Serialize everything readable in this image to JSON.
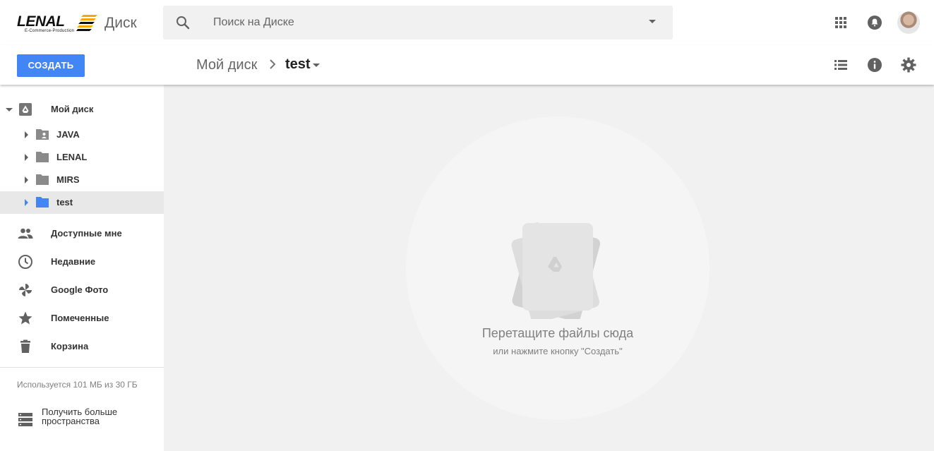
{
  "app": {
    "logo_text": "LENAL",
    "logo_tagline": "E-Commerce-Production",
    "product_name": "Диск"
  },
  "search": {
    "placeholder": "Поиск на Диске",
    "value": ""
  },
  "header_icons": [
    "apps-grid-icon",
    "notifications-bell-icon",
    "account-avatar"
  ],
  "toolbar": {
    "create_label": "СОЗДАТЬ",
    "view_icons": [
      "list-view-icon",
      "info-icon",
      "settings-gear-icon"
    ]
  },
  "breadcrumb": {
    "root": "Мой диск",
    "current": "test"
  },
  "sidebar": {
    "root_label": "Мой диск",
    "folders": [
      {
        "label": "JAVA",
        "icon": "shared-folder-icon",
        "selected": false
      },
      {
        "label": "LENAL",
        "icon": "folder-icon",
        "selected": false
      },
      {
        "label": "MIRS",
        "icon": "folder-icon",
        "selected": false
      },
      {
        "label": "test",
        "icon": "folder-icon",
        "selected": true
      }
    ],
    "nav": [
      {
        "label": "Доступные мне",
        "icon": "people-icon"
      },
      {
        "label": "Недавние",
        "icon": "clock-icon"
      },
      {
        "label": "Google Фото",
        "icon": "pinwheel-icon"
      },
      {
        "label": "Помеченные",
        "icon": "star-icon"
      },
      {
        "label": "Корзина",
        "icon": "trash-icon"
      }
    ],
    "storage_text": "Используется 101 МБ из 30 ГБ",
    "more_space_label": "Получить больше пространства"
  },
  "empty_state": {
    "title": "Перетащите файлы сюда",
    "subtitle": "или нажмите кнопку \"Создать\""
  },
  "colors": {
    "accent": "#4285f4",
    "main_bg": "#f1f1f1",
    "icon_gray": "#616161",
    "selected_row": "#e8e8e8"
  }
}
